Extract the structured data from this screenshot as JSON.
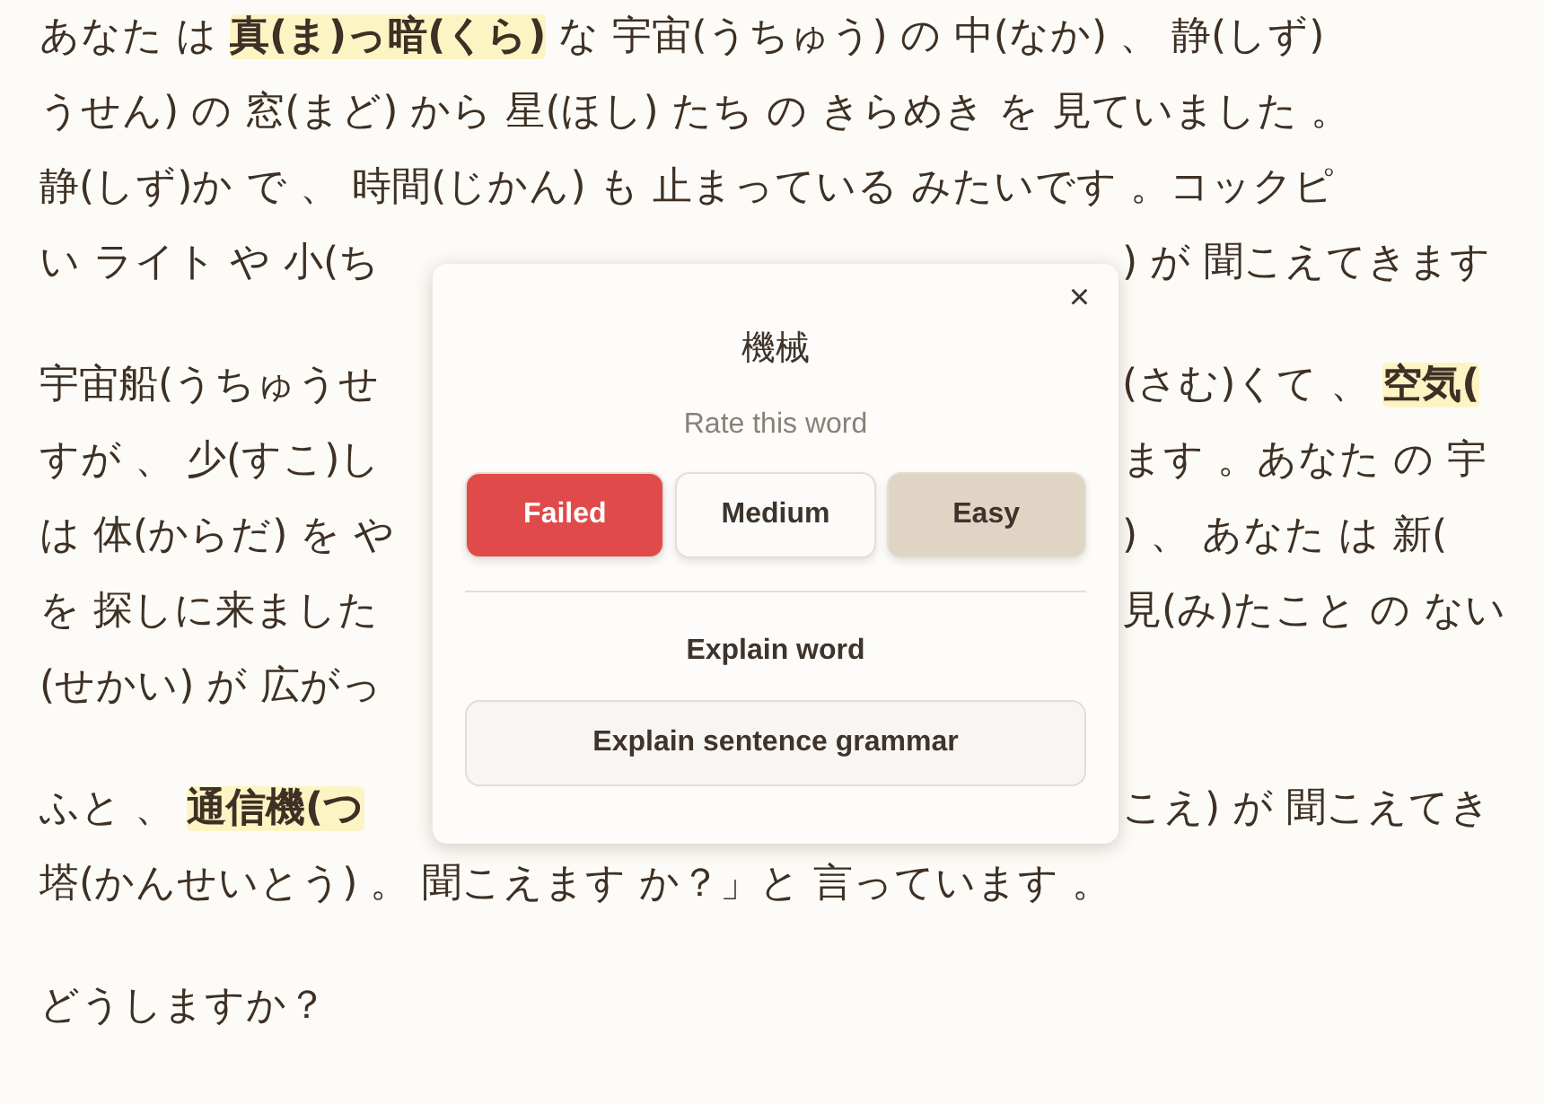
{
  "paragraphs": [
    {
      "lines": [
        {
          "spans": [
            {
              "text": "あなた は ",
              "highlighted": false
            },
            {
              "text": "真(ま)っ暗(くら)",
              "highlighted": true
            },
            {
              "text": " な 宇宙(うちゅう) の 中(なか) 、 静(しず)",
              "highlighted": false
            }
          ]
        },
        {
          "spans": [
            {
              "text": "うせん) の 窓(まど) から 星(ほし) たち の きらめき を 見ていました 。",
              "highlighted": false
            }
          ]
        },
        {
          "spans": [
            {
              "text": "静(しず)か で 、 時間(じかん) も 止まっている みたいです 。コックピ",
              "highlighted": false
            }
          ]
        },
        {
          "spans": [
            {
              "text": "い ライト や 小(ち",
              "highlighted": false
            }
          ],
          "right_spans": [
            {
              "text": ") が 聞こえてきます",
              "highlighted": false
            }
          ]
        }
      ]
    },
    {
      "lines": [
        {
          "spans": [
            {
              "text": "宇宙船(うちゅうせ",
              "highlighted": false
            }
          ],
          "right_spans": [
            {
              "text": "(さむ)くて 、 ",
              "highlighted": false
            },
            {
              "text": "空気(",
              "highlighted": true
            }
          ]
        },
        {
          "spans": [
            {
              "text": "すが 、 少(すこ)し",
              "highlighted": false
            }
          ],
          "right_spans": [
            {
              "text": "ます 。あなた の 宇",
              "highlighted": false
            }
          ]
        },
        {
          "spans": [
            {
              "text": "は 体(からだ) を や",
              "highlighted": false
            }
          ],
          "right_spans": [
            {
              "text": ") 、 あなた は 新(",
              "highlighted": false
            }
          ]
        },
        {
          "spans": [
            {
              "text": "を 探しに来ました",
              "highlighted": false
            }
          ],
          "right_spans": [
            {
              "text": "見(み)たこと の ない",
              "highlighted": false
            }
          ]
        },
        {
          "spans": [
            {
              "text": "(せかい) が 広がっ",
              "highlighted": false
            }
          ]
        }
      ]
    },
    {
      "lines": [
        {
          "spans": [
            {
              "text": "ふと 、 ",
              "highlighted": false
            },
            {
              "text": "通信機(つ",
              "highlighted": true
            }
          ],
          "right_spans": [
            {
              "text": "こえ) が 聞こえてき",
              "highlighted": false
            }
          ]
        },
        {
          "spans": [
            {
              "text": "塔(かんせいとう) 。 聞こえます か？」と 言っています 。",
              "highlighted": false
            }
          ]
        }
      ]
    },
    {
      "lines": [
        {
          "spans": [
            {
              "text": "どうしますか？",
              "highlighted": false
            }
          ]
        }
      ]
    }
  ],
  "popup": {
    "close": "×",
    "word": "機械",
    "prompt": "Rate this word",
    "ratings": [
      {
        "label": "Failed",
        "color": "#e04a4a"
      },
      {
        "label": "Medium",
        "color": "#fcfbf9"
      },
      {
        "label": "Easy",
        "color": "#e0d4c5"
      }
    ],
    "explain_word": "Explain word",
    "explain_sentence": "Explain sentence grammar"
  }
}
